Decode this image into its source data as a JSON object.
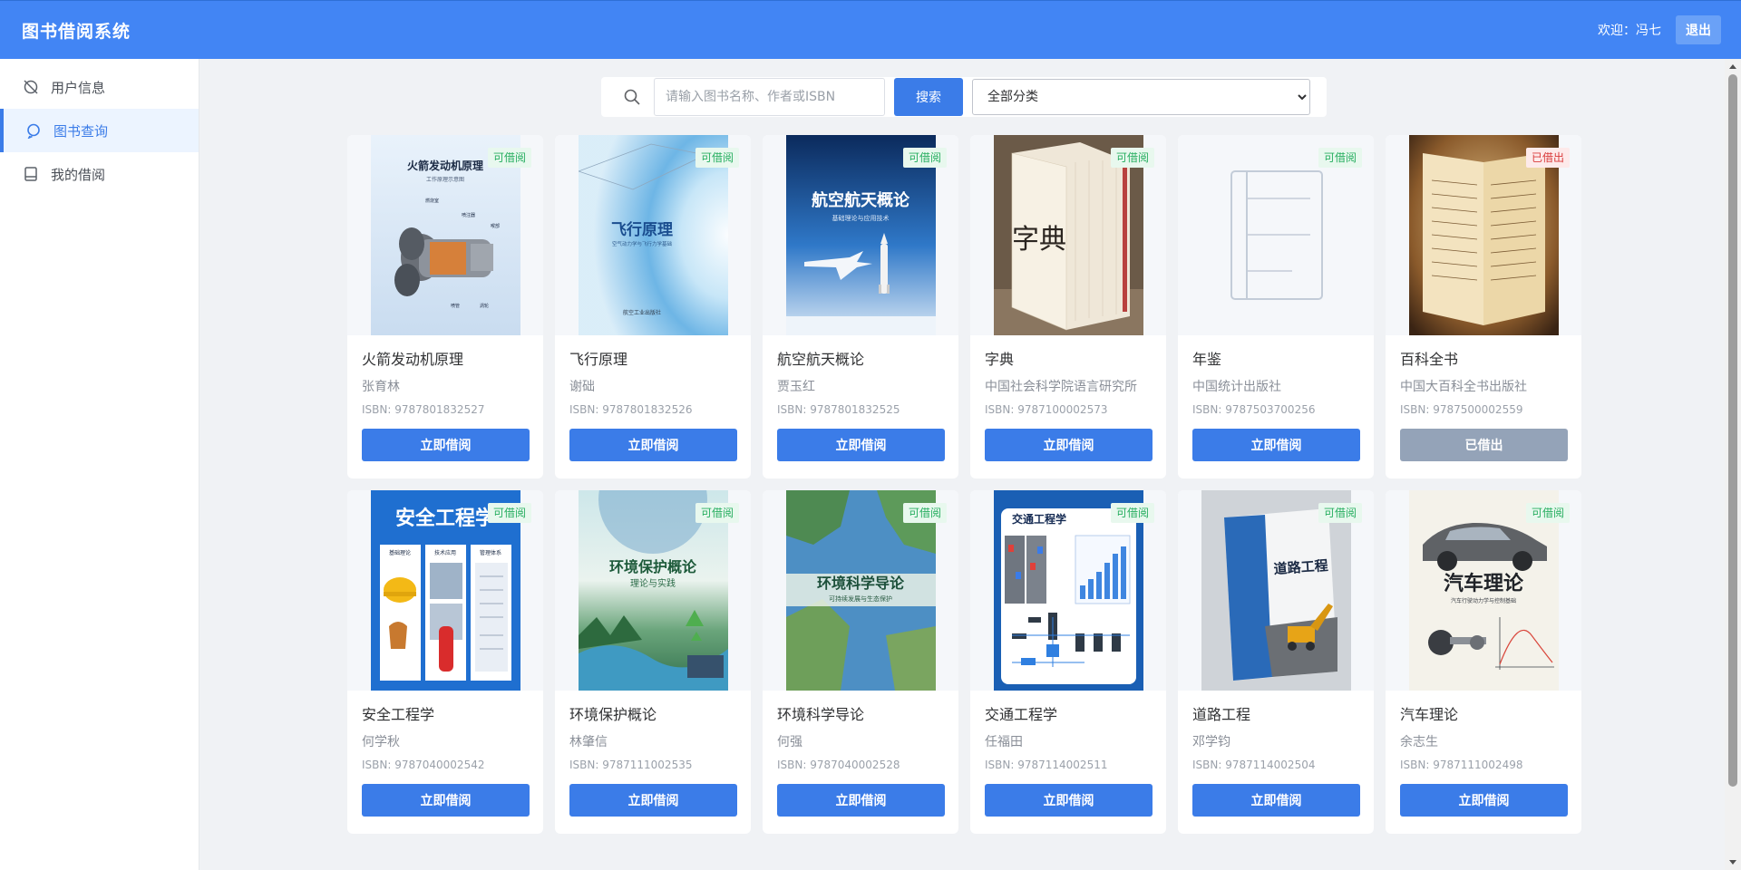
{
  "app": {
    "title": "图书借阅系统",
    "welcome": "欢迎：冯七",
    "logout_label": "退出"
  },
  "sidebar": {
    "items": [
      {
        "label": "用户信息",
        "icon": "user-info-icon",
        "active": false
      },
      {
        "label": "图书查询",
        "icon": "book-search-icon",
        "active": true
      },
      {
        "label": "我的借阅",
        "icon": "my-borrow-icon",
        "active": false
      }
    ]
  },
  "search": {
    "placeholder": "请输入图书名称、作者或ISBN",
    "value": "",
    "button_label": "搜索",
    "category_selected": "全部分类"
  },
  "colors": {
    "primary": "#3b7ce8",
    "header": "#4285f4",
    "available_badge_text": "#27ae60",
    "borrowed_badge_text": "#d93b3b",
    "disabled_button": "#94a3b8"
  },
  "books": [
    {
      "name": "火箭发动机原理",
      "author": "张育林",
      "isbn": "ISBN: 9787801832527",
      "status": "可借阅",
      "button": "立即借阅",
      "available": true,
      "cover": {
        "title": "火箭发动机原理",
        "subtitle": "工作原理示意图",
        "labels": [
          "燃烧室",
          "喷注器",
          "喉部",
          "喷管",
          "涡轮"
        ],
        "theme": "engine"
      }
    },
    {
      "name": "飞行原理",
      "author": "谢础",
      "isbn": "ISBN: 9787801832526",
      "status": "可借阅",
      "button": "立即借阅",
      "available": true,
      "cover": {
        "title": "飞行原理",
        "subtitle": "空气动力学与飞行力学基础",
        "publisher": "航空工业出版社",
        "theme": "flight"
      }
    },
    {
      "name": "航空航天概论",
      "author": "贾玉红",
      "isbn": "ISBN: 9787801832525",
      "status": "可借阅",
      "button": "立即借阅",
      "available": true,
      "cover": {
        "title": "航空航天概论",
        "subtitle": "基础理论与应用技术",
        "theme": "aerospace"
      }
    },
    {
      "name": "字典",
      "author": "中国社会科学院语言研究所",
      "isbn": "ISBN: 9787100002573",
      "status": "可借阅",
      "button": "立即借阅",
      "available": true,
      "cover": {
        "title": "字典",
        "theme": "dictionary"
      }
    },
    {
      "name": "年鉴",
      "author": "中国统计出版社",
      "isbn": "ISBN: 9787503700256",
      "status": "可借阅",
      "button": "立即借阅",
      "available": true,
      "cover": {
        "theme": "placeholder"
      }
    },
    {
      "name": "百科全书",
      "author": "中国大百科全书出版社",
      "isbn": "ISBN: 9787500002559",
      "status": "已借出",
      "button": "已借出",
      "available": false,
      "cover": {
        "theme": "encyclopedia"
      }
    },
    {
      "name": "安全工程学",
      "author": "何学秋",
      "isbn": "ISBN: 9787040002542",
      "status": "可借阅",
      "button": "立即借阅",
      "available": true,
      "cover": {
        "title": "安全工程学",
        "labels": [
          "基础理论",
          "技术应用",
          "管理体系"
        ],
        "theme": "safety"
      }
    },
    {
      "name": "环境保护概论",
      "author": "林肇信",
      "isbn": "ISBN: 9787111002535",
      "status": "可借阅",
      "button": "立即借阅",
      "available": true,
      "cover": {
        "title": "环境保护概论",
        "subtitle": "理论与实践",
        "theme": "environment"
      }
    },
    {
      "name": "环境科学导论",
      "author": "何强",
      "isbn": "ISBN: 9787040002528",
      "status": "可借阅",
      "button": "立即借阅",
      "available": true,
      "cover": {
        "title": "环境科学导论",
        "subtitle": "可持续发展与生态保护",
        "theme": "earth"
      }
    },
    {
      "name": "交通工程学",
      "author": "任福田",
      "isbn": "ISBN: 9787114002511",
      "status": "可借阅",
      "button": "立即借阅",
      "available": true,
      "cover": {
        "title": "交通工程学",
        "theme": "traffic"
      }
    },
    {
      "name": "道路工程",
      "author": "邓学钧",
      "isbn": "ISBN: 9787114002504",
      "status": "可借阅",
      "button": "立即借阅",
      "available": true,
      "cover": {
        "title": "道路工程",
        "theme": "road"
      }
    },
    {
      "name": "汽车理论",
      "author": "余志生",
      "isbn": "ISBN: 9787111002498",
      "status": "可借阅",
      "button": "立即借阅",
      "available": true,
      "cover": {
        "title": "汽车理论",
        "subtitle": "汽车行驶动力学与控制基础",
        "theme": "car"
      }
    }
  ]
}
